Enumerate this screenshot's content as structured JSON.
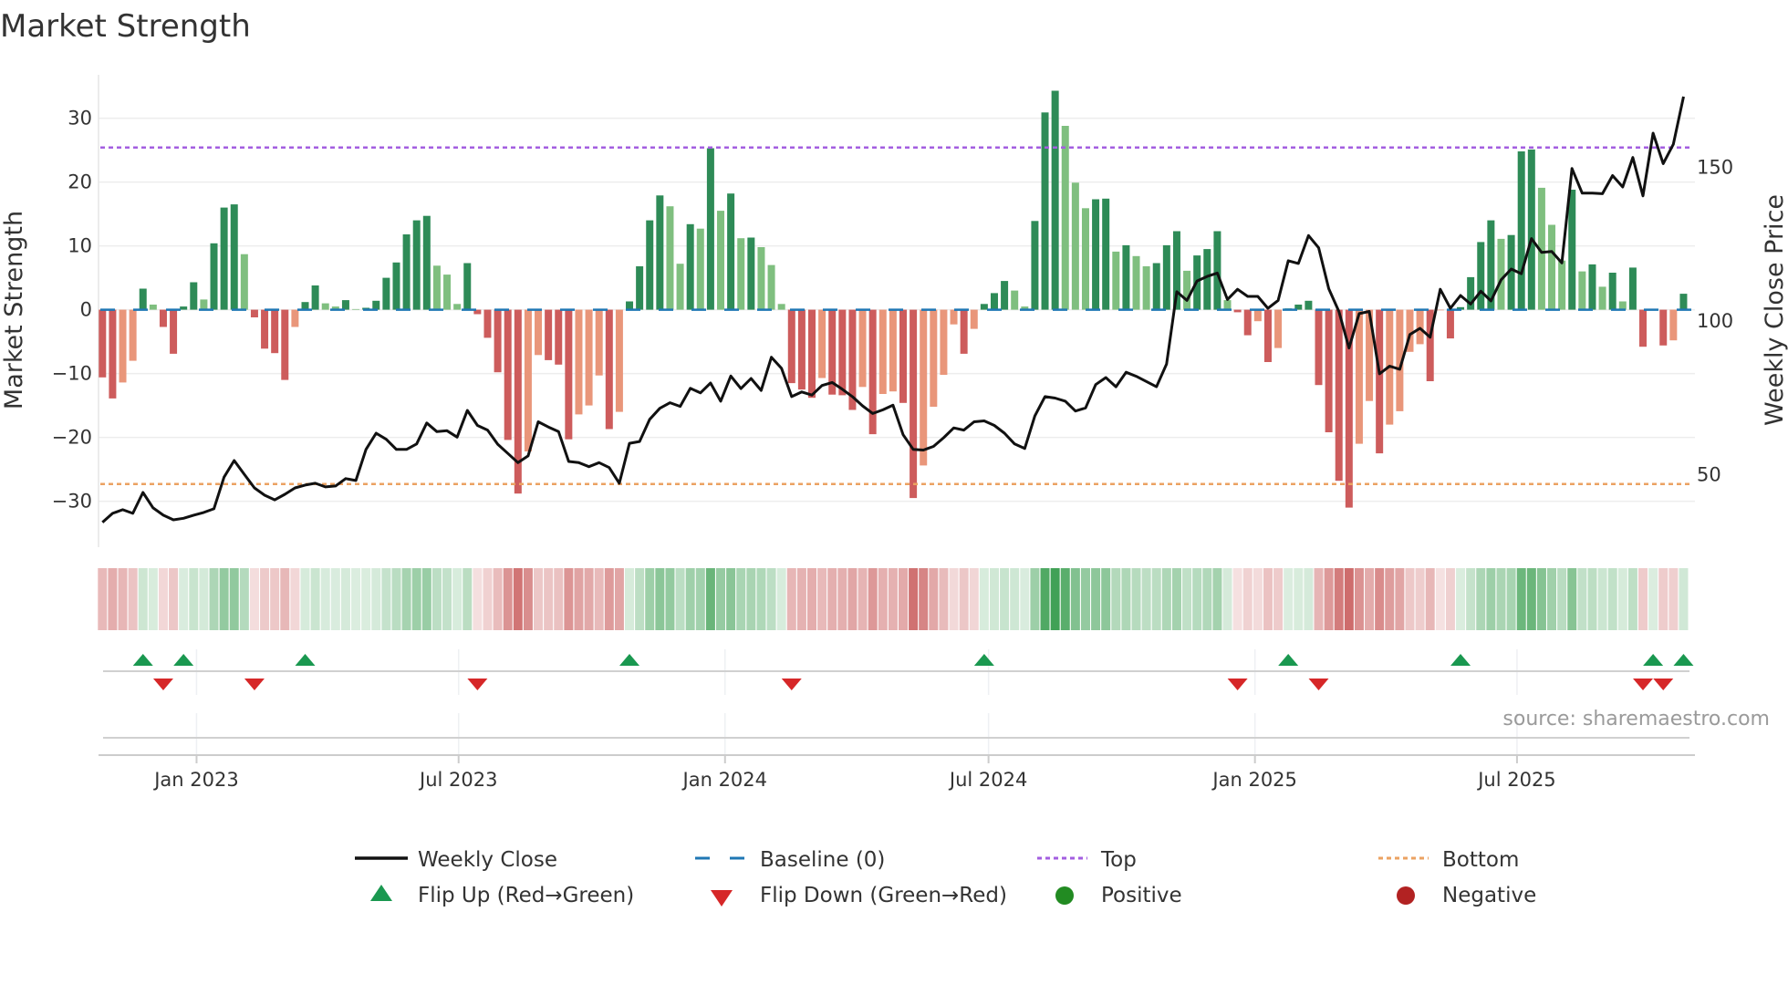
{
  "title": "Market Strength",
  "source": "source: sharemaestro.com",
  "chart_data": {
    "type": "bar",
    "title": "Market Strength",
    "ylabel": "Market Strength",
    "y2label": "Weekly Close Price",
    "xlabel": "",
    "ylim": [
      -37.2,
      36.8
    ],
    "y2lim": [
      26.4,
      180.1
    ],
    "grid": true,
    "legend_placement": "bottom",
    "yticks": [
      -30,
      -20,
      -10,
      0,
      10,
      20,
      30
    ],
    "ytick_labels": [
      "−30",
      "−20",
      "−10",
      "0",
      "10",
      "20",
      "30"
    ],
    "y2ticks": [
      50,
      100,
      150
    ],
    "y2tick_labels": [
      "50",
      "100",
      "150"
    ],
    "xticks": [
      {
        "label": "Jan 2023",
        "date": "2023-01-01"
      },
      {
        "label": "Jul 2023",
        "date": "2023-07-01"
      },
      {
        "label": "Jan 2024",
        "date": "2024-01-01"
      },
      {
        "label": "Jul 2024",
        "date": "2024-07-01"
      },
      {
        "label": "Jan 2025",
        "date": "2025-01-01"
      },
      {
        "label": "Jul 2025",
        "date": "2025-07-01"
      }
    ],
    "start_week": "2022-10-28",
    "frequency": "weekly",
    "baseline": 0,
    "top_level": 25.4,
    "bottom_level": -27.3,
    "strength": [
      -10.6,
      -13.9,
      -11.4,
      -8.0,
      3.3,
      0.8,
      -2.7,
      -6.9,
      0.5,
      4.3,
      1.6,
      10.4,
      16.0,
      16.5,
      8.7,
      -1.2,
      -6.1,
      -6.8,
      -11.0,
      -2.7,
      1.2,
      3.8,
      1.0,
      0.5,
      1.5,
      0.1,
      0.3,
      1.4,
      5.0,
      7.4,
      11.8,
      14.0,
      14.7,
      6.9,
      5.5,
      0.9,
      7.3,
      -0.7,
      -4.4,
      -9.8,
      -20.4,
      -28.8,
      -22.2,
      -7.1,
      -7.9,
      -8.6,
      -20.3,
      -16.4,
      -15.0,
      -10.3,
      -18.7,
      -16.0,
      1.3,
      6.8,
      14.0,
      17.9,
      16.2,
      7.2,
      13.4,
      12.7,
      25.3,
      15.5,
      18.2,
      11.2,
      11.3,
      9.8,
      7.0,
      0.9,
      -11.5,
      -12.5,
      -13.8,
      -10.7,
      -13.3,
      -13.4,
      -15.7,
      -12.1,
      -19.5,
      -13.2,
      -12.8,
      -14.6,
      -29.5,
      -24.4,
      -15.2,
      -10.2,
      -2.3,
      -6.9,
      -3.0,
      0.9,
      2.6,
      4.5,
      3.0,
      0.5,
      13.9,
      30.9,
      34.3,
      28.8,
      19.9,
      15.9,
      17.3,
      17.4,
      9.1,
      10.1,
      8.4,
      6.8,
      7.3,
      10.1,
      12.3,
      6.1,
      8.5,
      9.5,
      12.3,
      1.5,
      -0.4,
      -4.0,
      -1.8,
      -8.2,
      -6.0,
      0.2,
      0.8,
      1.4,
      -11.8,
      -19.2,
      -26.8,
      -31.0,
      -21.0,
      -14.3,
      -22.5,
      -18.0,
      -15.9,
      -6.6,
      -5.4,
      -11.2,
      -0.1,
      -4.5,
      0.4,
      5.1,
      10.6,
      14.0,
      11.1,
      11.7,
      24.8,
      25.1,
      19.1,
      13.3,
      7.7,
      18.8,
      6.0,
      7.1,
      3.6,
      5.8,
      1.3,
      6.6,
      -5.8,
      0.1,
      -5.6,
      -4.8,
      2.5
    ],
    "weekly_close": [
      34.5,
      37.4,
      38.6,
      37.4,
      44.2,
      39.2,
      36.8,
      35.3,
      35.8,
      36.8,
      37.7,
      38.9,
      49.2,
      54.6,
      50.1,
      45.7,
      43.3,
      41.8,
      43.6,
      45.7,
      46.6,
      47.2,
      46.0,
      46.3,
      48.7,
      48.1,
      58.2,
      63.5,
      61.5,
      58.2,
      58.2,
      60.0,
      66.8,
      64.0,
      64.3,
      62.2,
      70.9,
      66.0,
      64.5,
      59.9,
      56.9,
      53.9,
      56.1,
      67.2,
      65.5,
      64.0,
      54.3,
      53.9,
      52.6,
      53.9,
      52.3,
      47.2,
      60.2,
      60.8,
      68.0,
      71.6,
      73.4,
      72.2,
      78.1,
      76.6,
      79.8,
      73.9,
      82.1,
      78.0,
      81.3,
      77.4,
      88.2,
      84.6,
      75.4,
      76.9,
      75.9,
      79.0,
      80.0,
      77.8,
      75.4,
      72.4,
      69.9,
      71.1,
      72.6,
      63.0,
      58.2,
      58.0,
      59.2,
      62.0,
      65.2,
      64.5,
      67.2,
      67.5,
      66.0,
      63.5,
      60.0,
      58.5,
      69.1,
      75.4,
      74.9,
      73.9,
      70.7,
      71.7,
      79.3,
      81.6,
      78.6,
      83.3,
      82.0,
      80.3,
      78.6,
      86.0,
      109.5,
      106.7,
      113.0,
      114.5,
      115.6,
      107.0,
      110.3,
      108.0,
      108.0,
      104.1,
      106.7,
      119.6,
      118.7,
      127.8,
      123.8,
      110.5,
      103.1,
      91.2,
      102.4,
      103.1,
      82.8,
      85.3,
      84.3,
      95.6,
      97.6,
      94.7,
      110.3,
      104.1,
      108.3,
      105.5,
      109.7,
      106.5,
      113.4,
      116.9,
      115.4,
      126.8,
      122.3,
      122.6,
      118.9,
      149.6,
      141.6,
      141.6,
      141.4,
      147.3,
      143.6,
      153.2,
      140.7,
      161.1,
      151.2,
      157.5,
      173.0
    ],
    "legend": [
      {
        "label": "Weekly Close",
        "marker": "solid-line"
      },
      {
        "label": "Baseline (0)",
        "marker": "dashed-line"
      },
      {
        "label": "Top",
        "marker": "dotted-line"
      },
      {
        "label": "Bottom",
        "marker": "dotted-line"
      },
      {
        "label": "Flip Up (Red→Green)",
        "marker": "triangle-up"
      },
      {
        "label": "Flip Down (Green→Red)",
        "marker": "triangle-down"
      },
      {
        "label": "Positive",
        "marker": "circle"
      },
      {
        "label": "Negative",
        "marker": "circle"
      }
    ],
    "colors": {
      "pos_rising": "#2e8b57",
      "pos_falling": "#7fbf7f",
      "neg_falling": "#cd5c5c",
      "neg_rising": "#e9967a",
      "price": "#111111",
      "baseline": "#1f77b4",
      "top": "#a35ee0",
      "bottom": "#eba262",
      "heat_pos": "#3a9e50",
      "heat_neg": "#c85a5a",
      "flip_up": "#1a9850",
      "flip_down": "#d62728",
      "positive": "#228b22",
      "negative": "#b22222"
    }
  }
}
